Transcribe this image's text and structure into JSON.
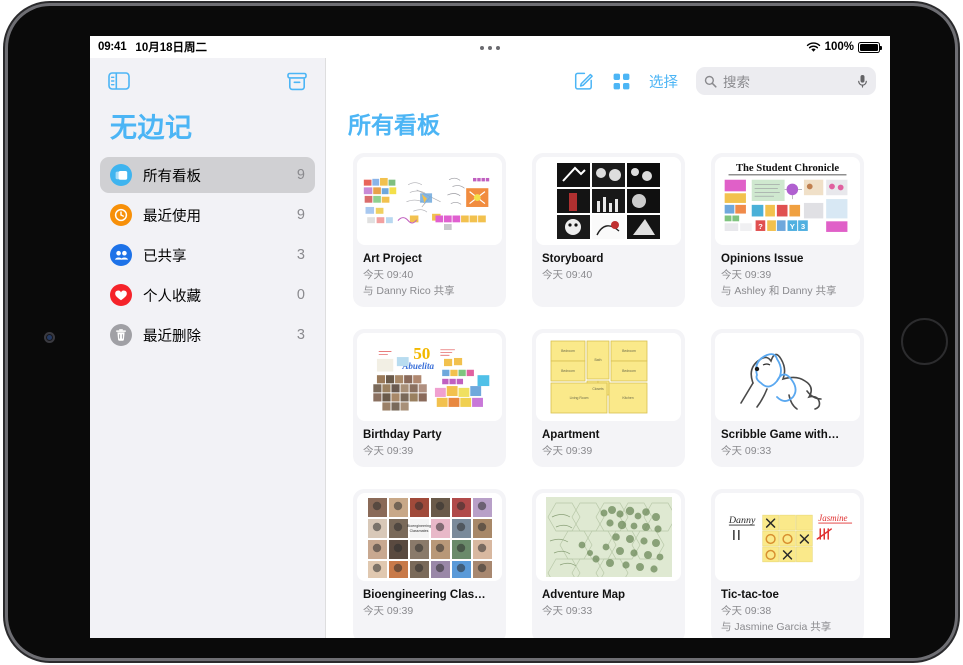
{
  "status_bar": {
    "time": "09:41",
    "date": "10月18日周二",
    "battery_percent": "100%",
    "wifi_icon": "wifi-icon",
    "battery_icon": "battery-icon"
  },
  "sidebar": {
    "app_title": "无边记",
    "toolbar": {
      "sidebar_toggle_icon": "sidebar-toggle-icon",
      "new_folder_icon": "new-folder-icon"
    },
    "items": [
      {
        "label": "所有看板",
        "count": "9",
        "icon": "boards-icon",
        "color": "#3fb4ef",
        "selected": true
      },
      {
        "label": "最近使用",
        "count": "9",
        "icon": "clock-icon",
        "color": "#f79009",
        "selected": false
      },
      {
        "label": "已共享",
        "count": "3",
        "icon": "people-icon",
        "color": "#1d72e8",
        "selected": false
      },
      {
        "label": "个人收藏",
        "count": "0",
        "icon": "heart-icon",
        "color": "#f5232a",
        "selected": false
      },
      {
        "label": "最近删除",
        "count": "3",
        "icon": "trash-icon",
        "color": "#a0a0a5",
        "selected": false
      }
    ]
  },
  "main": {
    "title": "所有看板",
    "toolbar": {
      "compose_icon": "compose-icon",
      "grid_view_icon": "grid-view-icon",
      "select_label": "选择"
    },
    "search": {
      "placeholder": "搜索",
      "value": "",
      "search_icon": "search-icon",
      "mic_icon": "microphone-icon"
    },
    "boards": [
      {
        "title": "Art Project",
        "date": "今天 09:40",
        "shared": "与 Danny Rico 共享",
        "thumb": "art-project-thumb"
      },
      {
        "title": "Storyboard",
        "date": "今天 09:40",
        "shared": "",
        "thumb": "storyboard-thumb"
      },
      {
        "title": "Opinions Issue",
        "date": "今天 09:39",
        "shared": "与 Ashley 和 Danny 共享",
        "thumb": "opinions-issue-thumb"
      },
      {
        "title": "Birthday Party",
        "date": "今天 09:39",
        "shared": "",
        "thumb": "birthday-party-thumb"
      },
      {
        "title": "Apartment",
        "date": "今天 09:39",
        "shared": "",
        "thumb": "apartment-thumb"
      },
      {
        "title": "Scribble Game with…",
        "date": "今天 09:33",
        "shared": "",
        "thumb": "scribble-game-thumb"
      },
      {
        "title": "Bioengineering Clas…",
        "date": "今天 09:39",
        "shared": "",
        "thumb": "bioengineering-thumb"
      },
      {
        "title": "Adventure Map",
        "date": "今天 09:33",
        "shared": "",
        "thumb": "adventure-map-thumb"
      },
      {
        "title": "Tic-tac-toe",
        "date": "今天 09:38",
        "shared": "与 Jasmine Garcia 共享",
        "thumb": "tic-tac-toe-thumb"
      }
    ]
  },
  "theme": {
    "accent": "#4cb5f5",
    "sidebar_bg": "#f2f2f6",
    "card_bg": "#f4f4f7",
    "secondary_text": "#8a8a8e"
  }
}
